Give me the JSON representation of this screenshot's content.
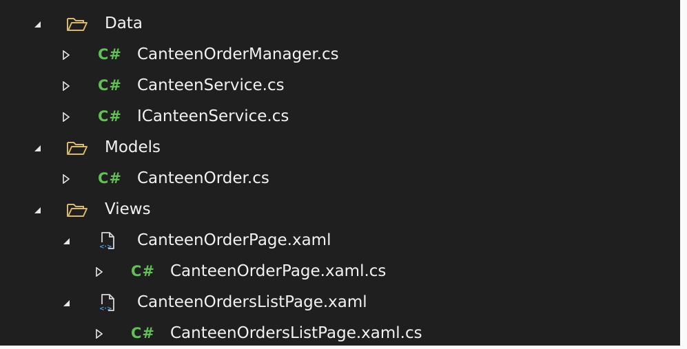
{
  "tree": {
    "data_folder": {
      "label": "Data",
      "icon": "folder-open-icon",
      "expanded": true
    },
    "data_items": [
      {
        "label": "CanteenOrderManager.cs",
        "icon_text": "C#",
        "icon": "csharp-file-icon",
        "expanded": false
      },
      {
        "label": "CanteenService.cs",
        "icon_text": "C#",
        "icon": "csharp-file-icon",
        "expanded": false
      },
      {
        "label": "ICanteenService.cs",
        "icon_text": "C#",
        "icon": "csharp-file-icon",
        "expanded": false
      }
    ],
    "models_folder": {
      "label": "Models",
      "icon": "folder-open-icon",
      "expanded": true
    },
    "models_items": [
      {
        "label": "CanteenOrder.cs",
        "icon_text": "C#",
        "icon": "csharp-file-icon",
        "expanded": false
      }
    ],
    "views_folder": {
      "label": "Views",
      "icon": "folder-open-icon",
      "expanded": true
    },
    "views_items": [
      {
        "label": "CanteenOrderPage.xaml",
        "icon": "xaml-file-icon",
        "expanded": true,
        "child": {
          "label": "CanteenOrderPage.xaml.cs",
          "icon_text": "C#",
          "icon": "csharp-file-icon",
          "expanded": false
        }
      },
      {
        "label": "CanteenOrdersListPage.xaml",
        "icon": "xaml-file-icon",
        "expanded": true,
        "child": {
          "label": "CanteenOrdersListPage.xaml.cs",
          "icon_text": "C#",
          "icon": "csharp-file-icon",
          "expanded": false
        }
      }
    ]
  },
  "colors": {
    "background": "#1f1f1f",
    "text": "#f1f1f1",
    "csharp_icon": "#61c154",
    "folder_icon": "#d8b86a",
    "xaml_icon": "#4f9fe6"
  }
}
